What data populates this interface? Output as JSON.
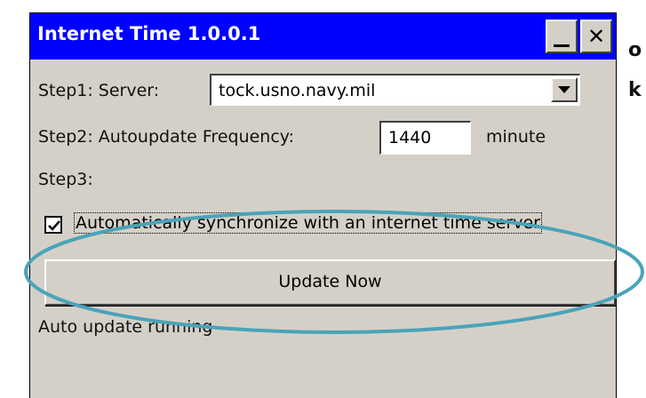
{
  "background_fragments": {
    "line1": "o",
    "line2": "k"
  },
  "window": {
    "title": "Internet Time 1.0.0.1",
    "titlebar_color": "#0000ff",
    "minimize_icon": "minimize-icon",
    "close_icon": "close-icon",
    "close_glyph": "✕"
  },
  "step1": {
    "label": "Step1: Server:",
    "server_value": "tock.usno.navy.mil",
    "dropdown_icon": "chevron-down-icon"
  },
  "step2": {
    "label": "Step2: Autoupdate Frequency:",
    "frequency_value": "1440",
    "unit_label": "minute"
  },
  "step3": {
    "label": "Step3:"
  },
  "auto_sync": {
    "checked": true,
    "label": "Automatically synchronize with an internet time server"
  },
  "update_button": {
    "label": "Update Now"
  },
  "status": {
    "text": "Auto update running"
  },
  "annotation": {
    "color": "#4aa3b8",
    "shape": "ellipse highlighting Update Now button"
  }
}
